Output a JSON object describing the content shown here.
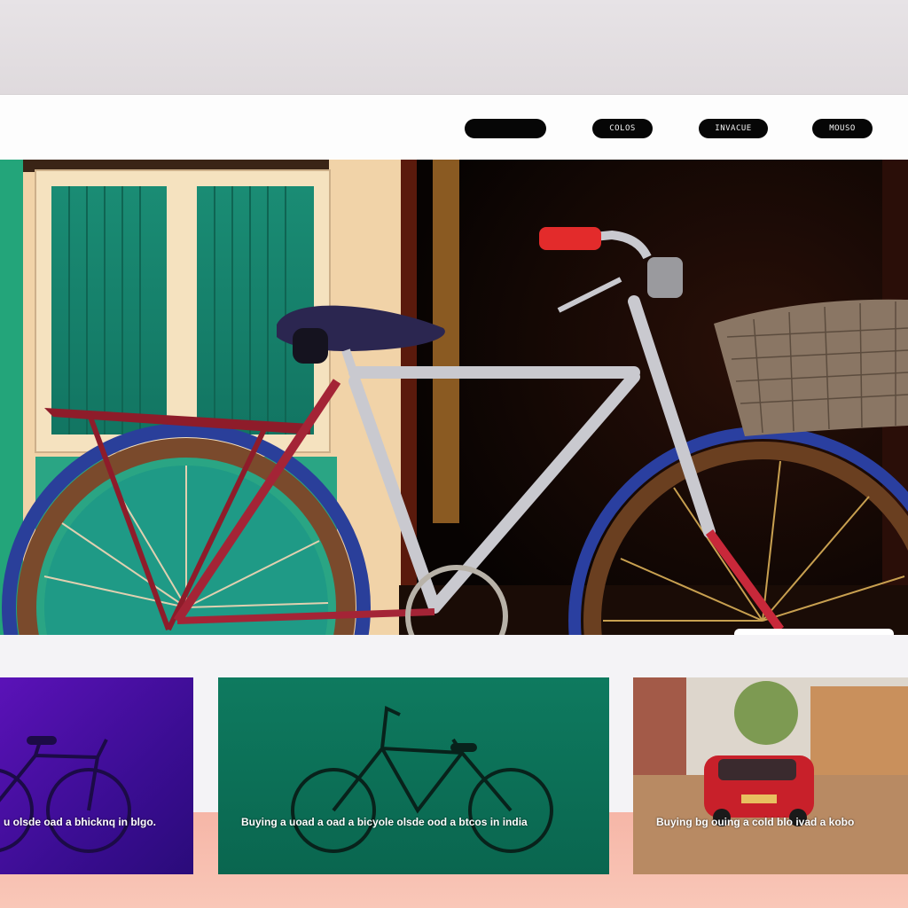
{
  "nav": {
    "items": [
      {
        "label": ""
      },
      {
        "label": "COLOS"
      },
      {
        "label": "INVACUE"
      },
      {
        "label": "MOUSO"
      }
    ]
  },
  "hero": {
    "search_placeholder": ""
  },
  "cards": [
    {
      "caption": "u olsde oad a bhicknq in blgo."
    },
    {
      "caption": "Buying a uoad a oad a bicyole olsde ood a btcos in india"
    },
    {
      "caption": "Buying bg ouing a cold blo ivad a kobo"
    }
  ],
  "colors": {
    "nav_pill": "#060606",
    "card_purple": "#4a10a8",
    "card_green": "#0d735a",
    "pink_strip": "#f7bcaf"
  }
}
